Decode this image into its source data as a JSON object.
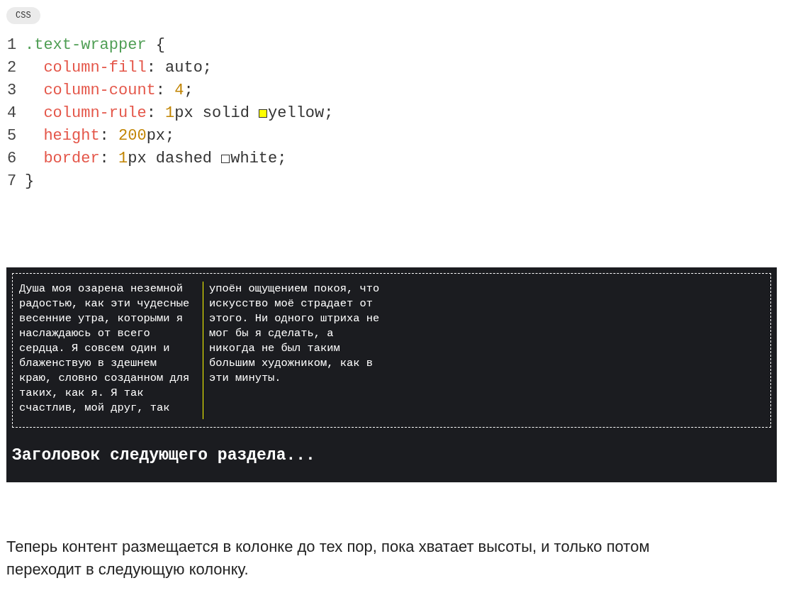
{
  "language_tag": "CSS",
  "code_lines": [
    {
      "number": "1",
      "tokens": [
        {
          "kind": "selector",
          "text": ".text-wrapper"
        },
        {
          "kind": "plain",
          "text": " {"
        }
      ]
    },
    {
      "number": "2",
      "indented": true,
      "tokens": [
        {
          "kind": "property",
          "text": "column-fill"
        },
        {
          "kind": "plain",
          "text": ": auto;"
        }
      ]
    },
    {
      "number": "3",
      "indented": true,
      "tokens": [
        {
          "kind": "property",
          "text": "column-count"
        },
        {
          "kind": "plain",
          "text": ": "
        },
        {
          "kind": "number",
          "text": "4"
        },
        {
          "kind": "plain",
          "text": ";"
        }
      ]
    },
    {
      "number": "4",
      "indented": true,
      "tokens": [
        {
          "kind": "property",
          "text": "column-rule"
        },
        {
          "kind": "plain",
          "text": ": "
        },
        {
          "kind": "number",
          "text": "1"
        },
        {
          "kind": "plain",
          "text": "px solid "
        },
        {
          "kind": "swatch",
          "color": "#ffff00"
        },
        {
          "kind": "plain",
          "text": "yellow;"
        }
      ]
    },
    {
      "number": "5",
      "indented": true,
      "tokens": [
        {
          "kind": "property",
          "text": "height"
        },
        {
          "kind": "plain",
          "text": ": "
        },
        {
          "kind": "number",
          "text": "200"
        },
        {
          "kind": "plain",
          "text": "px;"
        }
      ]
    },
    {
      "number": "6",
      "indented": true,
      "tokens": [
        {
          "kind": "property",
          "text": "border"
        },
        {
          "kind": "plain",
          "text": ": "
        },
        {
          "kind": "number",
          "text": "1"
        },
        {
          "kind": "plain",
          "text": "px dashed "
        },
        {
          "kind": "swatch",
          "color": "#ffffff"
        },
        {
          "kind": "plain",
          "text": "white;"
        }
      ]
    },
    {
      "number": "7",
      "tokens": [
        {
          "kind": "plain",
          "text": "}"
        }
      ]
    }
  ],
  "demo": {
    "columns": [
      [
        "Душа моя озарена неземной",
        "радостью, как эти чудесные",
        "весенние утра, которыми я",
        "наслаждаюсь от всего",
        "сердца. Я совсем один и",
        "блаженствую в здешнем",
        "краю, словно созданном для",
        "таких, как я. Я так",
        "счастлив, мой друг, так"
      ],
      [
        "упоён ощущением покоя, что",
        "искусство моё страдает от",
        "этого. Ни одного штриха не",
        "мог бы я сделать, а",
        "никогда не был таким",
        "большим художником, как в",
        "эти минуты."
      ]
    ],
    "heading": "Заголовок следующего раздела..."
  },
  "paragraph": "Теперь контент размещается в колонке до тех пор, пока хватает высоты, и только потом переходит в следующую колонку."
}
